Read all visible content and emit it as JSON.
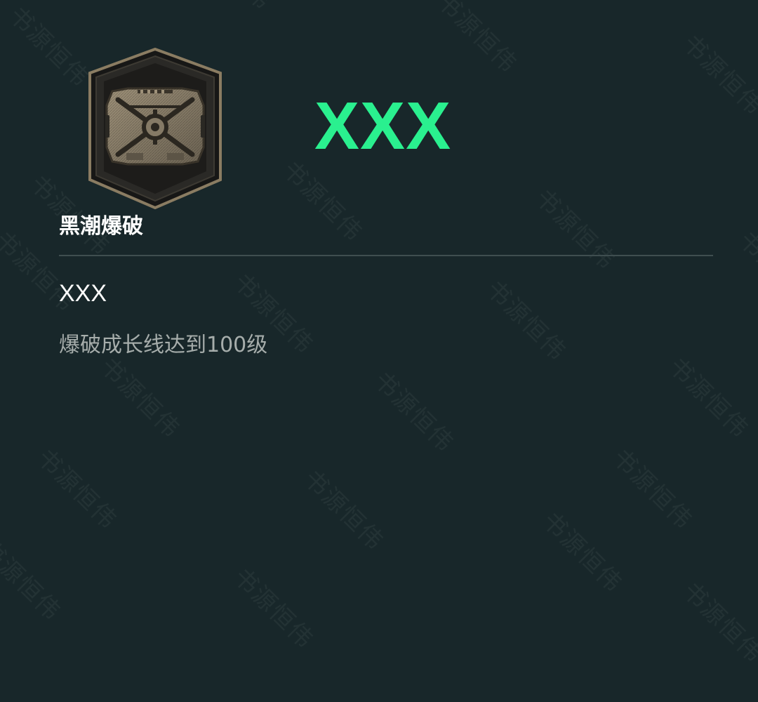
{
  "badge": {
    "icon": "shield-badge-icon"
  },
  "header": {
    "title": "XXX",
    "accent_color": "#2af08f"
  },
  "mode": {
    "name": "黑潮爆破"
  },
  "achievement": {
    "title": "XXX",
    "description": "爆破成长线达到100级"
  },
  "watermark": {
    "text": "书源恒伟"
  },
  "colors": {
    "background": "#18272a",
    "divider": "#3f4e50",
    "description_text": "#a6adab"
  }
}
